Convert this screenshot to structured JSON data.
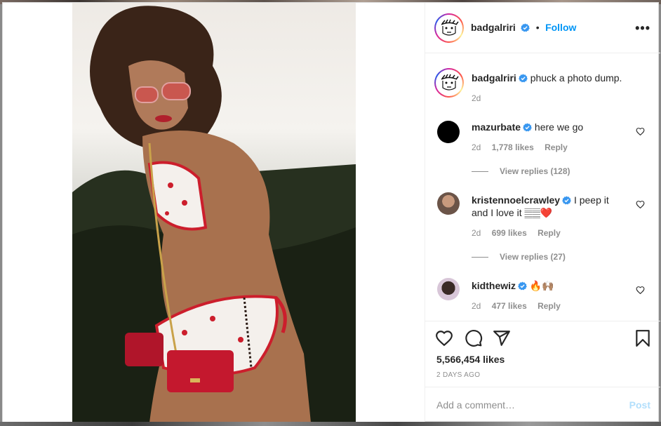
{
  "post": {
    "username": "badgalriri",
    "follow_label": "Follow",
    "more_label": "•••",
    "caption": "phuck a photo dump.",
    "caption_age": "2d",
    "likes": "5,566,454 likes",
    "date": "2 DAYS AGO",
    "comment_placeholder": "Add a comment…",
    "post_label": "Post"
  },
  "comments": [
    {
      "username": "mazurbate",
      "text": "here we go",
      "age": "2d",
      "likes": "1,778 likes",
      "reply": "Reply",
      "view_replies": "View replies (128)",
      "avatar_color": "#000000"
    },
    {
      "username": "kristennoelcrawley",
      "text_line1": "I peep it",
      "text_line2": "and I love it 𝄛𝄛❤️",
      "age": "2d",
      "likes": "699 likes",
      "reply": "Reply",
      "view_replies": "View replies (27)",
      "avatar_color": "#6b5448"
    },
    {
      "username": "kidthewiz",
      "text": "🔥🙌🏽",
      "age": "2d",
      "likes": "477 likes",
      "reply": "Reply",
      "avatar_color": "#3a2a26"
    }
  ],
  "colors": {
    "link": "#0095f6",
    "muted": "#8e8e8e",
    "verified": "#3897f0",
    "post_disabled": "#b2dffc"
  },
  "icons": {
    "like": "heart-icon",
    "comment": "comment-icon",
    "share": "paper-plane-icon",
    "save": "bookmark-icon",
    "verified": "verified-badge-icon"
  }
}
